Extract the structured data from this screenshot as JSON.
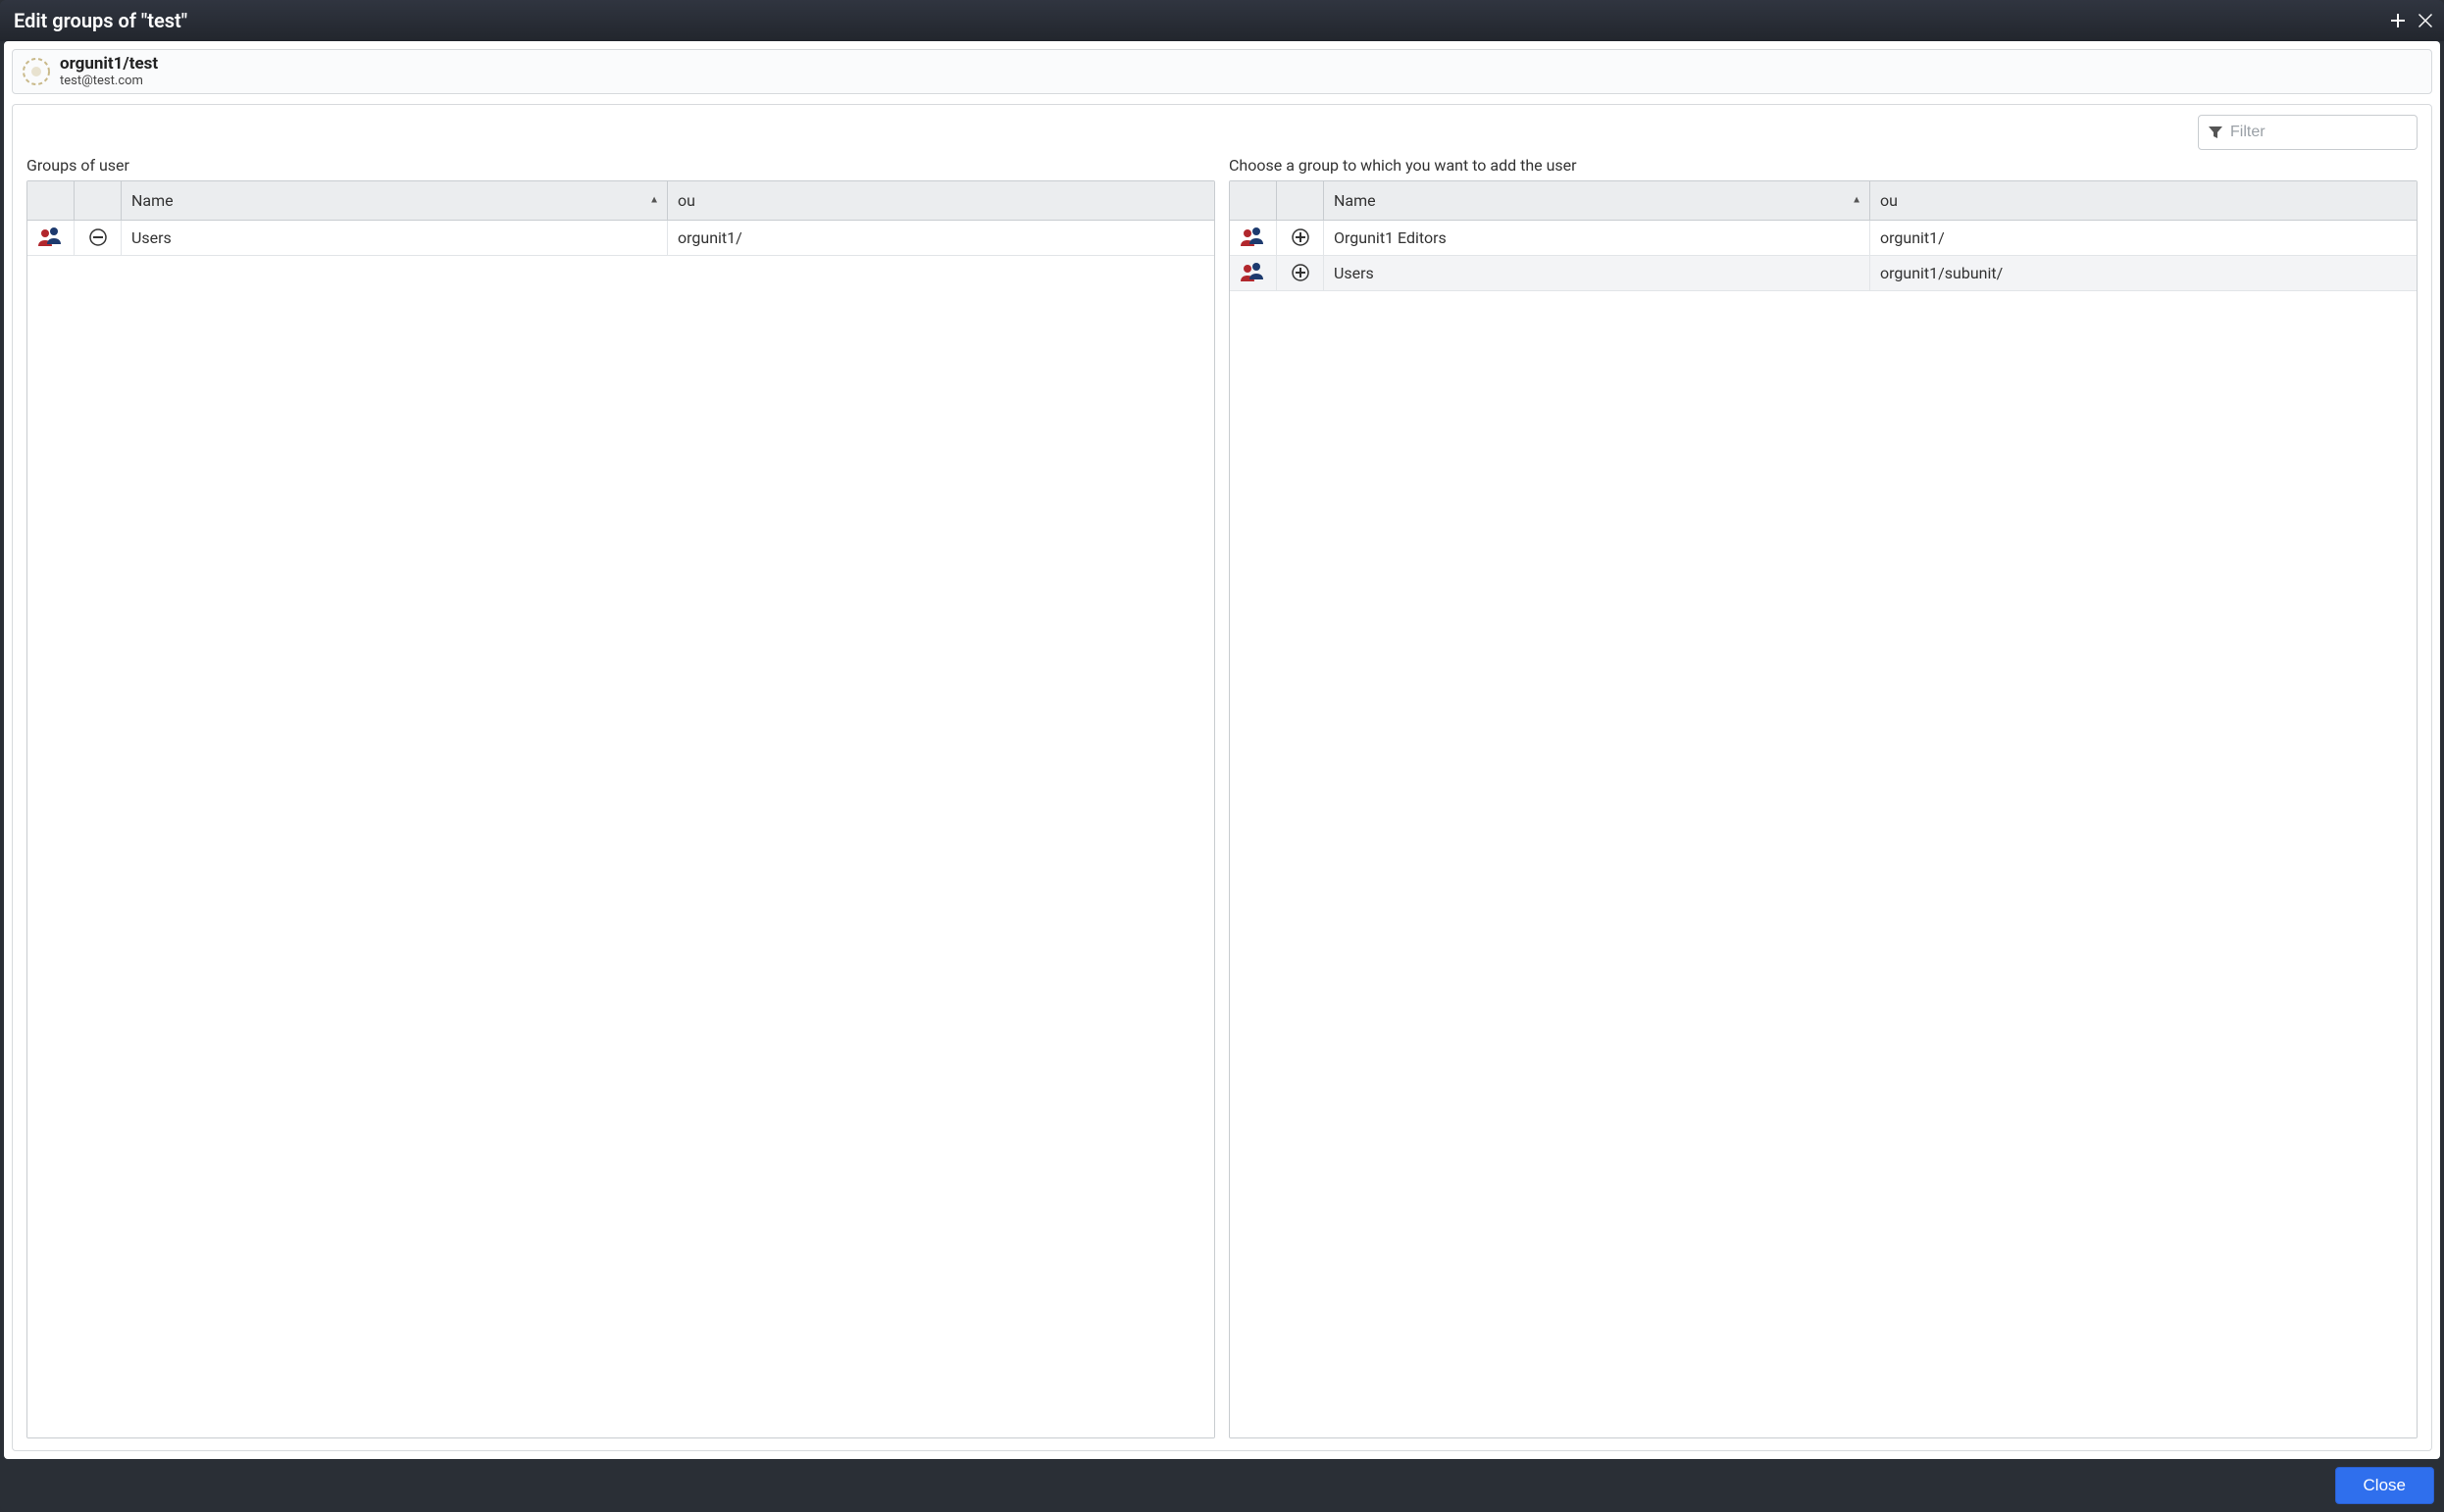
{
  "dialog": {
    "title": "Edit groups of \"test\"",
    "add_tooltip": "Add",
    "close_tooltip": "Close"
  },
  "user": {
    "path": "orgunit1/test",
    "email": "test@test.com"
  },
  "filter": {
    "placeholder": "Filter"
  },
  "left": {
    "label": "Groups of user",
    "columns": {
      "name": "Name",
      "ou": "ou"
    },
    "rows": [
      {
        "name": "Users",
        "ou": "orgunit1/"
      }
    ]
  },
  "right": {
    "label": "Choose a group to which you want to add the user",
    "columns": {
      "name": "Name",
      "ou": "ou"
    },
    "rows": [
      {
        "name": "Orgunit1 Editors",
        "ou": "orgunit1/"
      },
      {
        "name": "Users",
        "ou": "orgunit1/subunit/"
      }
    ]
  },
  "footer": {
    "close_label": "Close"
  }
}
